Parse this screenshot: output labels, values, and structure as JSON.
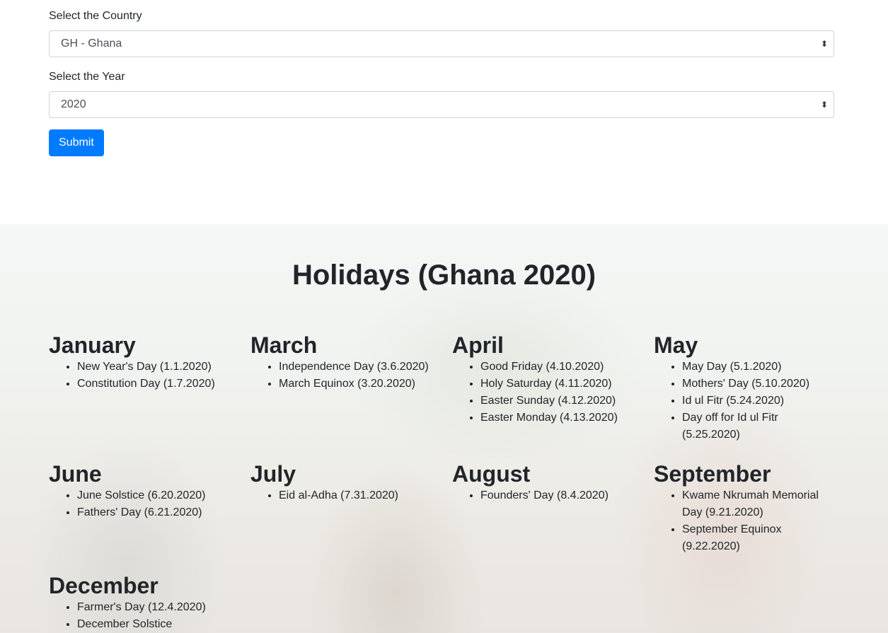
{
  "form": {
    "country_label": "Select the Country",
    "country_value": "GH - Ghana",
    "year_label": "Select the Year",
    "year_value": "2020",
    "submit_label": "Submit"
  },
  "holidays": {
    "title": "Holidays (Ghana 2020)",
    "months": [
      {
        "name": "January",
        "items": [
          "New Year's Day (1.1.2020)",
          "Constitution Day (1.7.2020)"
        ]
      },
      {
        "name": "March",
        "items": [
          "Independence Day (3.6.2020)",
          "March Equinox (3.20.2020)"
        ]
      },
      {
        "name": "April",
        "items": [
          "Good Friday (4.10.2020)",
          "Holy Saturday (4.11.2020)",
          "Easter Sunday (4.12.2020)",
          "Easter Monday (4.13.2020)"
        ]
      },
      {
        "name": "May",
        "items": [
          "May Day (5.1.2020)",
          "Mothers' Day (5.10.2020)",
          "Id ul Fitr (5.24.2020)",
          "Day off for Id ul Fitr (5.25.2020)"
        ]
      },
      {
        "name": "June",
        "items": [
          "June Solstice (6.20.2020)",
          "Fathers' Day (6.21.2020)"
        ]
      },
      {
        "name": "July",
        "items": [
          "Eid al-Adha (7.31.2020)"
        ]
      },
      {
        "name": "August",
        "items": [
          "Founders' Day (8.4.2020)"
        ]
      },
      {
        "name": "September",
        "items": [
          "Kwame Nkrumah Memorial Day (9.21.2020)",
          "September Equinox (9.22.2020)"
        ]
      },
      {
        "name": "December",
        "items": [
          "Farmer's Day (12.4.2020)",
          "December Solstice"
        ]
      }
    ]
  },
  "colors": {
    "primary": "#007bff",
    "text": "#212529",
    "border": "#ced4da"
  }
}
